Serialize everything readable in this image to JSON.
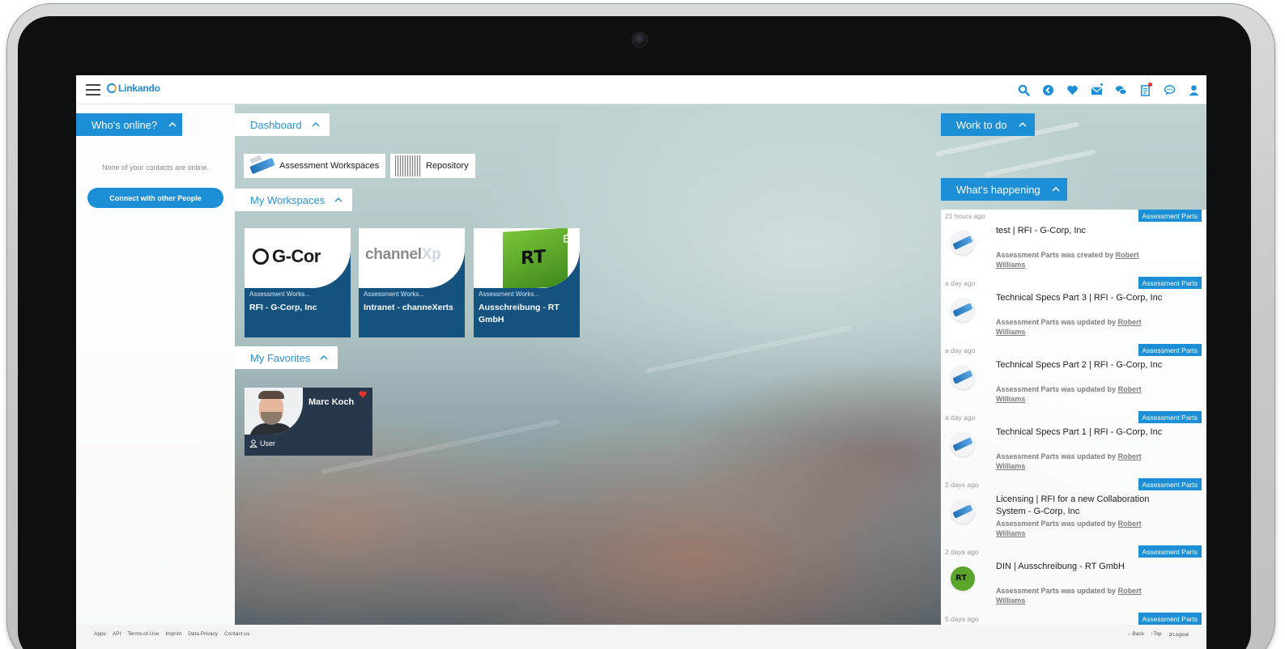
{
  "app": {
    "logo_text": "Linkando"
  },
  "topbar": {
    "icons": [
      "search-icon",
      "back-circle-icon",
      "heart-icon",
      "mail-icon",
      "chat-bubbles-icon",
      "tasks-icon",
      "comment-icon",
      "user-icon"
    ],
    "accent": "#1c8fd6"
  },
  "left": {
    "header": "Who's online?",
    "empty_text": "None of your contacts are online.",
    "connect_label": "Connect with other People"
  },
  "center": {
    "dashboard_header": "Dashboard",
    "shortcuts": [
      {
        "label": "Assessment Workspaces"
      },
      {
        "label": "Repository"
      }
    ],
    "workspaces_header": "My Workspaces",
    "workspaces": [
      {
        "logo_text": "G-Cor",
        "kind": "Assessment Works...",
        "title": "RFI - G-Corp, Inc"
      },
      {
        "logo_text": "channel",
        "logo_accent": "Xp",
        "kind": "Assessment Works...",
        "title": "Intranet - channeXerts"
      },
      {
        "logo_text": "RT",
        "kind": "Assessment Works...",
        "title": "Ausschreibung - RT GmbH"
      }
    ],
    "favorites_header": "My Favorites",
    "favorites": [
      {
        "name": "Marc Koch",
        "role": "User"
      }
    ]
  },
  "right": {
    "work_header": "Work to do",
    "happening_header": "What's happening",
    "feed": [
      {
        "time": "21 hours ago",
        "badge": "Assessment Parts",
        "title": "test | RFI - G-Corp, Inc",
        "desc": "Assessment Parts was created by",
        "user": "Robert Williams",
        "icon": "pen"
      },
      {
        "time": "a day ago",
        "badge": "Assessment Parts",
        "title": "Technical Specs Part 3 | RFI - G-Corp, Inc",
        "desc": "Assessment Parts was updated by",
        "user": "Robert Williams",
        "icon": "pen"
      },
      {
        "time": "a day ago",
        "badge": "Assessment Parts",
        "title": "Technical Specs Part 2 | RFI - G-Corp, Inc",
        "desc": "Assessment Parts was updated by",
        "user": "Robert Williams",
        "icon": "pen"
      },
      {
        "time": "a day ago",
        "badge": "Assessment Parts",
        "title": "Technical Specs Part 1 | RFI - G-Corp, Inc",
        "desc": "Assessment Parts was updated by",
        "user": "Robert Williams",
        "icon": "pen"
      },
      {
        "time": "2 days ago",
        "badge": "Assessment Parts",
        "title": "Licensing | RFI for a new Collaboration System - G-Corp, Inc",
        "desc": "Assessment Parts was updated by",
        "user": "Robert Williams",
        "icon": "pen"
      },
      {
        "time": "2 days ago",
        "badge": "Assessment Parts",
        "title": "DIN | Ausschreibung - RT GmbH",
        "desc": "Assessment Parts was updated by",
        "user": "Robert Williams",
        "icon": "rt"
      },
      {
        "time": "5 days ago",
        "badge": "Assessment Parts",
        "title": "",
        "desc": "",
        "user": "",
        "icon": "pen"
      }
    ]
  },
  "footer": {
    "links": [
      "Apps",
      "API",
      "Terms-of-Use",
      "Imprint",
      "Data Privacy",
      "Contact-us"
    ],
    "nav": [
      "Back",
      "Top",
      "Logout"
    ]
  }
}
